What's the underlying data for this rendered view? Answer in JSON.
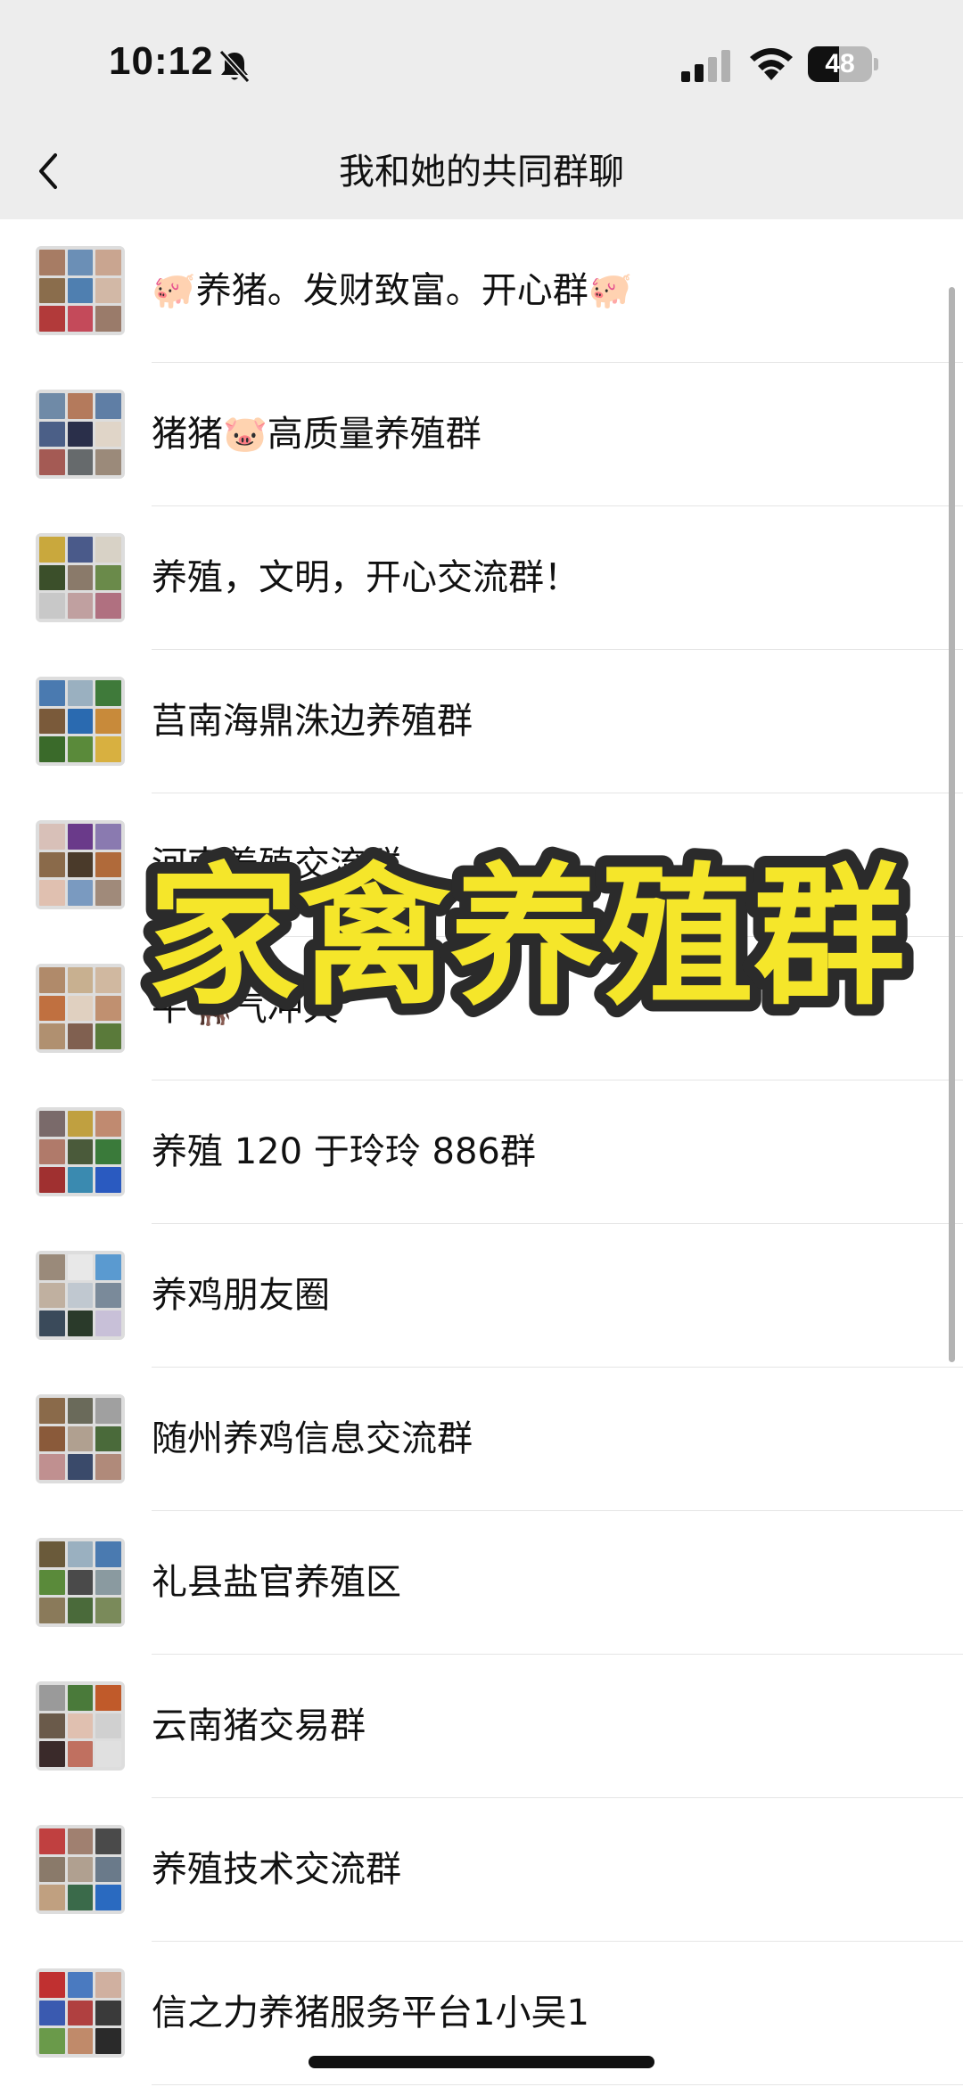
{
  "status_bar": {
    "time": "10:12",
    "battery_level": "48",
    "battery_fraction": 0.48,
    "icons": [
      "bell-slash-icon",
      "cellular-signal-icon",
      "wifi-icon",
      "battery-icon"
    ]
  },
  "nav": {
    "back_icon": "chevron-left-icon",
    "title": "我和她的共同群聊"
  },
  "groups": [
    {
      "name": "🐖养猪。发财致富。开心群🐖",
      "avatar_colors": [
        "#a77c64",
        "#6b8fb6",
        "#c9a590",
        "#8a6d4c",
        "#4f7fb0",
        "#d2b8a6",
        "#b23a3a",
        "#c44a5a",
        "#9a7b6a"
      ]
    },
    {
      "name": "猪猪🐷高质量养殖群",
      "avatar_colors": [
        "#6f8aa7",
        "#b47a5c",
        "#5f7ea5",
        "#4b5f87",
        "#2a2f4a",
        "#e0d5c8",
        "#a45a54",
        "#666a6c",
        "#9b8a7a"
      ]
    },
    {
      "name": "养殖，文明，开心交流群！",
      "avatar_colors": [
        "#c9a83d",
        "#4a5a8a",
        "#d8d2c6",
        "#3b4f2a",
        "#8a7a6a",
        "#6a8a4a",
        "#c8c8c8",
        "#c0a0a0",
        "#b07080"
      ]
    },
    {
      "name": "莒南海鼎洙边养殖群",
      "avatar_colors": [
        "#4a7ab0",
        "#9ab0c0",
        "#3f7a3a",
        "#7a5a3a",
        "#2a6ab0",
        "#c88a3a",
        "#3a6a2a",
        "#5a8a3a",
        "#d8b040"
      ]
    },
    {
      "name": "河南养殖交流群",
      "avatar_colors": [
        "#d8c0b8",
        "#6a3a8a",
        "#8a7ab0",
        "#8a6a4a",
        "#4a3a2a",
        "#b06a3a",
        "#e0c0b0",
        "#7a9ac0",
        "#a08a7a"
      ]
    },
    {
      "name": "牛🐂气冲天",
      "avatar_colors": [
        "#b08a6a",
        "#c8b090",
        "#d0b8a0",
        "#c07040",
        "#e0d0c0",
        "#c09070",
        "#b09070",
        "#806050",
        "#5a7a3a"
      ]
    },
    {
      "name": "养殖 120 于玲玲 886群",
      "avatar_colors": [
        "#7a6a6a",
        "#c0a040",
        "#c08a70",
        "#b07a6a",
        "#4a5a3a",
        "#3a7a3a",
        "#a03030",
        "#3a8ab0",
        "#2a5ac0"
      ]
    },
    {
      "name": "养鸡朋友圈",
      "avatar_colors": [
        "#9a8a7a",
        "#e8e8e8",
        "#5a9ad0",
        "#c0b0a0",
        "#c0c8d0",
        "#7a8a9a",
        "#3a4a5a",
        "#2a3a2a",
        "#c8c0d8"
      ]
    },
    {
      "name": "随州养鸡信息交流群",
      "avatar_colors": [
        "#8a6a4a",
        "#6a6a5a",
        "#a0a0a0",
        "#8a5a3a",
        "#b0a090",
        "#4a6a3a",
        "#c09090",
        "#3a4a6a",
        "#b08a7a"
      ]
    },
    {
      "name": "礼县盐官养殖区",
      "avatar_colors": [
        "#6a5a3a",
        "#9ab0c0",
        "#4a7ab0",
        "#5a8a3a",
        "#4a4a4a",
        "#8a9aa0",
        "#8a7a5a",
        "#4a6a3a",
        "#7a8a5a"
      ]
    },
    {
      "name": "云南猪交易群",
      "avatar_colors": [
        "#9a9a9a",
        "#4a7a3a",
        "#c05a2a",
        "#6a5a4a",
        "#e0c0b0",
        "#d0d0d0",
        "#3a2a2a",
        "#c07060",
        "#e0e0e0"
      ]
    },
    {
      "name": "养殖技术交流群",
      "avatar_colors": [
        "#c04040",
        "#a08070",
        "#4a4a4a",
        "#8a7a6a",
        "#b0a090",
        "#6a7a8a",
        "#c0a080",
        "#3a6a4a",
        "#2a6ac0"
      ]
    },
    {
      "name": "信之力养猪服务平台1小吴1",
      "avatar_colors": [
        "#c03030",
        "#4a7ac0",
        "#d0b0a0",
        "#3a5ab0",
        "#b04040",
        "#3a3a3a",
        "#6a9a4a",
        "#c08a6a",
        "#2a2a2a"
      ]
    }
  ],
  "overlay": {
    "text": "家禽养殖群",
    "fill_color": "#f5e62a",
    "stroke_color": "#2b2b2b"
  }
}
